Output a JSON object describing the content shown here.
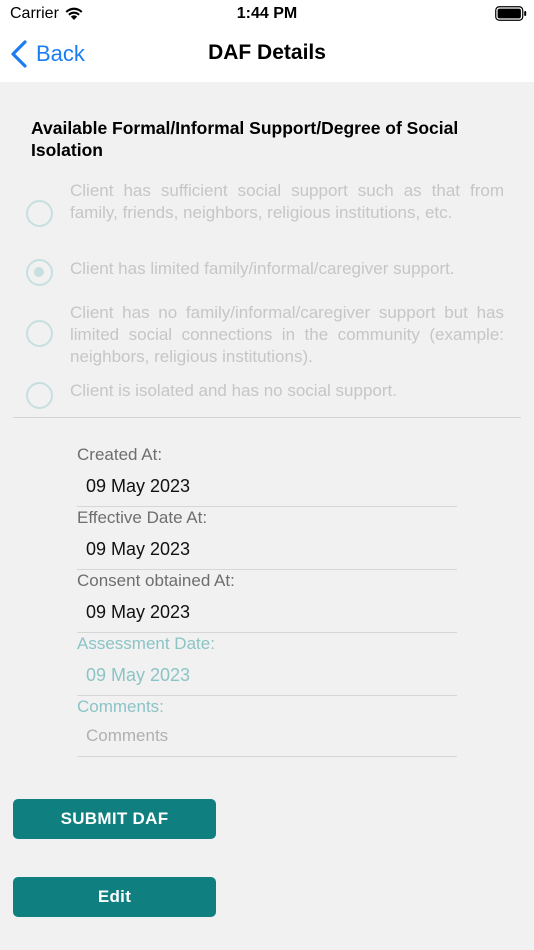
{
  "status_bar": {
    "carrier": "Carrier",
    "time": "1:44 PM"
  },
  "nav": {
    "back_label": "Back",
    "title": "DAF Details"
  },
  "section": {
    "title": "Available Formal/Informal Support/Degree of Social Isolation",
    "options": [
      {
        "label": "Client has sufficient social support such as that from family, friends, neighbors, religious institutions, etc.",
        "selected": false
      },
      {
        "label": "Client has limited family/informal/caregiver support.",
        "selected": true
      },
      {
        "label": "Client has no family/informal/caregiver support but has limited social connections in the community (example: neighbors, religious institutions).",
        "selected": false
      },
      {
        "label": "Client is isolated and has no social support.",
        "selected": false
      }
    ]
  },
  "fields": {
    "created_at": {
      "label": "Created At:",
      "value": "09 May 2023"
    },
    "effective_date": {
      "label": "Effective Date At:",
      "value": "09 May 2023"
    },
    "consent_obtained": {
      "label": "Consent obtained At:",
      "value": "09 May 2023"
    },
    "assessment_date": {
      "label": "Assessment Date:",
      "value": "09 May 2023"
    },
    "comments": {
      "label": "Comments:",
      "placeholder": "Comments"
    }
  },
  "buttons": {
    "submit_label": "SUBMIT DAF",
    "edit_label": "Edit"
  },
  "colors": {
    "accent_blue": "#1a7ef2",
    "teal_button": "#0f7f7f",
    "teal_disabled": "#8cc4c6",
    "background": "#f1f1f1"
  }
}
